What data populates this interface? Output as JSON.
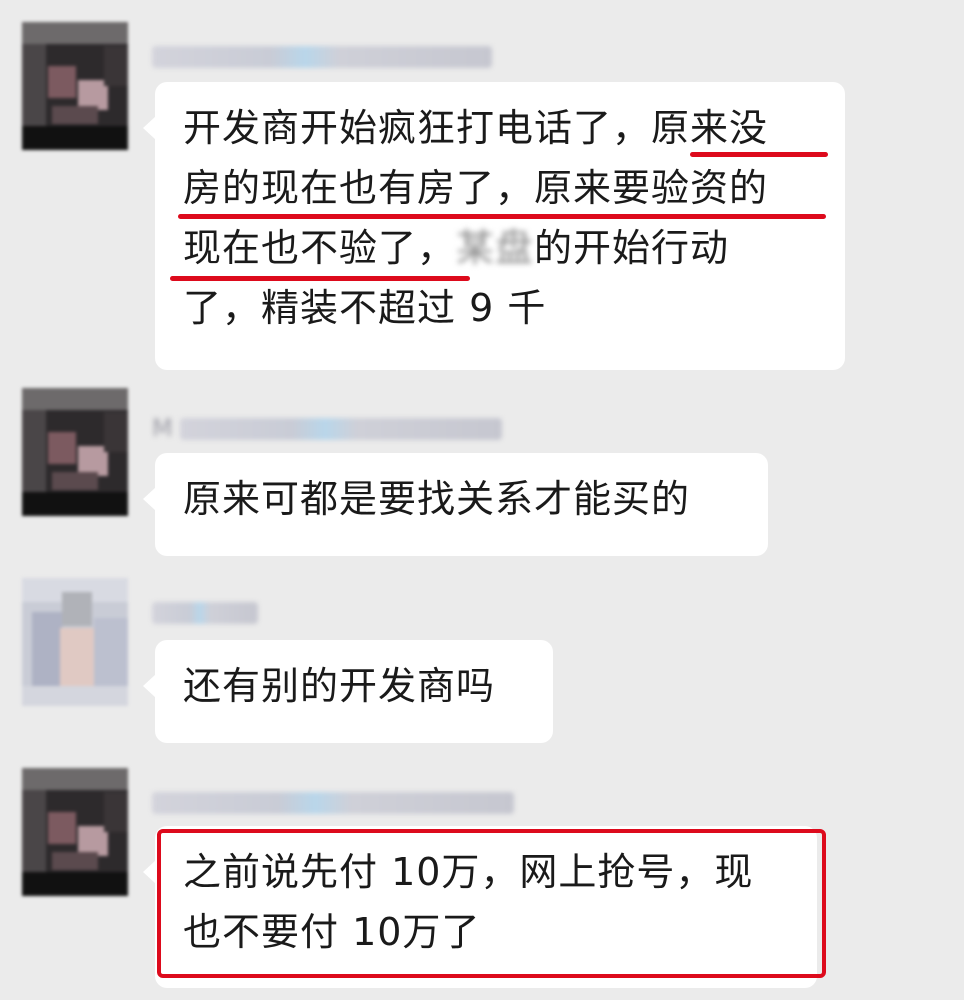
{
  "messages": [
    {
      "lines": [
        [
          "开发商开始疯狂打电话了，",
          "原来没"
        ],
        [
          "房的现在也有房了，原来要验资的"
        ],
        [
          "现在也不验了，",
          "某盘",
          "的开始行动"
        ],
        [
          "了，精装不超过 9 千"
        ]
      ]
    },
    {
      "sender": "M",
      "lines": [
        [
          "原来可都是要找关系才能买的"
        ]
      ]
    },
    {
      "lines": [
        [
          "还有别的开发商吗"
        ]
      ]
    },
    {
      "lines": [
        [
          "之前说先付 10万，网上抢号，现"
        ],
        [
          "也不要付 10万了"
        ]
      ]
    }
  ],
  "markup_color": "#dd0a1c",
  "bubble_color": "#ffffff",
  "background_color": "#ebebeb"
}
